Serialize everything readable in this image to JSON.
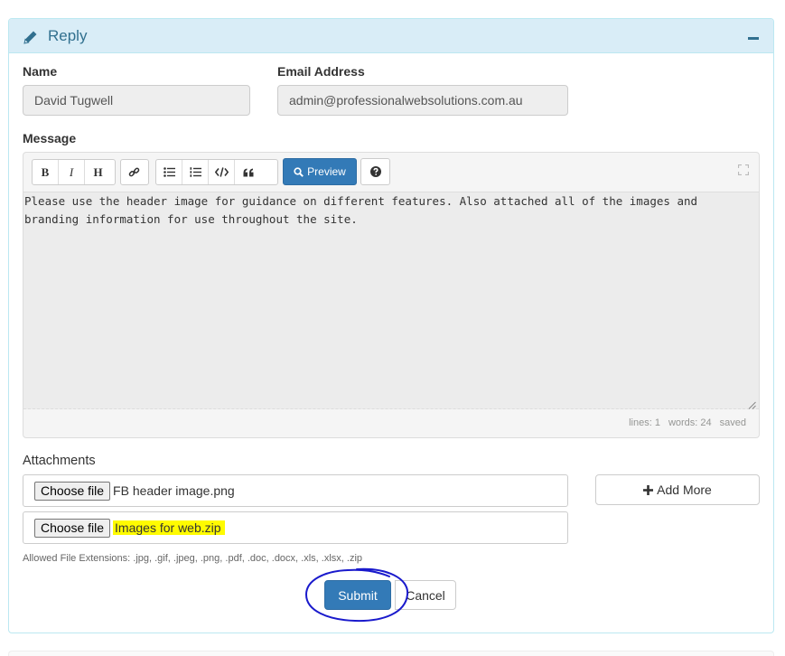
{
  "panel": {
    "title": "Reply"
  },
  "name": {
    "label": "Name",
    "value": "David Tugwell"
  },
  "email": {
    "label": "Email Address",
    "value": "admin@professionalwebsolutions.com.au"
  },
  "message": {
    "label": "Message",
    "toolbar": {
      "bold": "B",
      "italic": "I",
      "heading": "H",
      "preview_label": "Preview"
    },
    "text": "Please use the header image for guidance on different features. Also attached all of the images and\nbranding information for use throughout the site.",
    "status": {
      "lines": "lines: 1",
      "words": "words: 24",
      "saved": "saved"
    }
  },
  "attachments": {
    "label": "Attachments",
    "choose_label": "Choose file",
    "files": [
      "FB header image.png",
      "Images for web.zip"
    ],
    "add_more_label": "Add More",
    "allowed": "Allowed File Extensions: .jpg, .gif, .jpeg, .png, .pdf, .doc, .docx, .xls, .xlsx, .zip"
  },
  "actions": {
    "submit_label": "Submit",
    "cancel_label": "Cancel"
  },
  "colors": {
    "primary": "#337ab7",
    "panel_heading_bg": "#d9edf7",
    "panel_heading_text": "#31708f",
    "highlight": "#fffb00",
    "annotation_circle": "#1a1acc"
  }
}
